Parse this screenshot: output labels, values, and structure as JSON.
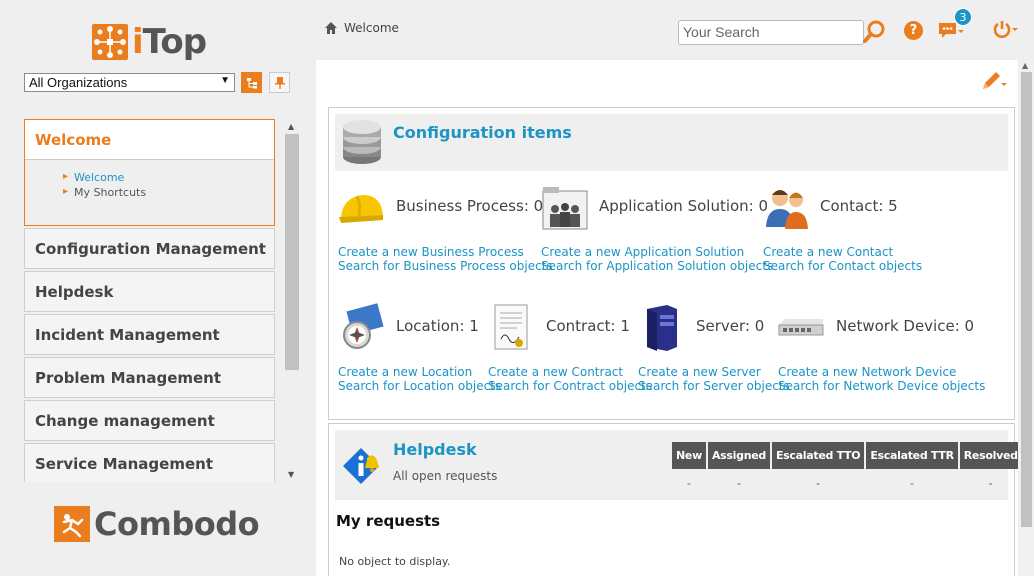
{
  "brand": {
    "logo_text_i": "i",
    "logo_text_rest": "Top",
    "footer_logo": "Combodo"
  },
  "org_selector": {
    "value": "All Organizations"
  },
  "menu": {
    "groups": [
      {
        "label": "Welcome",
        "active": true
      },
      {
        "label": "Configuration Management"
      },
      {
        "label": "Helpdesk"
      },
      {
        "label": "Incident Management"
      },
      {
        "label": "Problem Management"
      },
      {
        "label": "Change management"
      },
      {
        "label": "Service Management"
      }
    ],
    "welcome_items": [
      {
        "label": "Welcome"
      },
      {
        "label": "My Shortcuts"
      }
    ]
  },
  "topbar": {
    "breadcrumb": "Welcome",
    "search_placeholder": "Your Search",
    "help_icon_label": "?",
    "notification_count": "3"
  },
  "config_items": {
    "title": "Configuration items",
    "items": [
      {
        "name": "Business Process: 0",
        "create": "Create a new Business Process",
        "search": "Search for Business Process objects",
        "icon": "helmet-icon"
      },
      {
        "name": "Application Solution: 0",
        "create": "Create a new Application Solution",
        "search": "Search for Application Solution objects",
        "icon": "application-solution-icon"
      },
      {
        "name": "Contact: 5",
        "create": "Create a new Contact",
        "search": "Search for Contact objects",
        "icon": "contacts-icon"
      },
      {
        "name": "Location: 1",
        "create": "Create a new Location",
        "search": "Search for Location objects",
        "icon": "location-compass-icon"
      },
      {
        "name": "Contract: 1",
        "create": "Create a new Contract",
        "search": "Search for Contract objects",
        "icon": "contract-icon"
      },
      {
        "name": "Server: 0",
        "create": "Create a new Server",
        "search": "Search for Server objects",
        "icon": "server-icon"
      },
      {
        "name": "Network Device: 0",
        "create": "Create a new Network Device",
        "search": "Search for Network Device objects",
        "icon": "network-device-icon"
      }
    ]
  },
  "helpdesk": {
    "title": "Helpdesk",
    "subtitle": "All open requests",
    "columns": [
      "New",
      "Assigned",
      "Escalated TTO",
      "Escalated TTR",
      "Resolved"
    ],
    "values": [
      "-",
      "-",
      "-",
      "-",
      "-"
    ]
  },
  "my_requests": {
    "title": "My requests",
    "empty_text": "No object to display."
  },
  "colors": {
    "accent": "#ea7d1e",
    "link": "#1c94c4",
    "header_dark": "#555555"
  }
}
